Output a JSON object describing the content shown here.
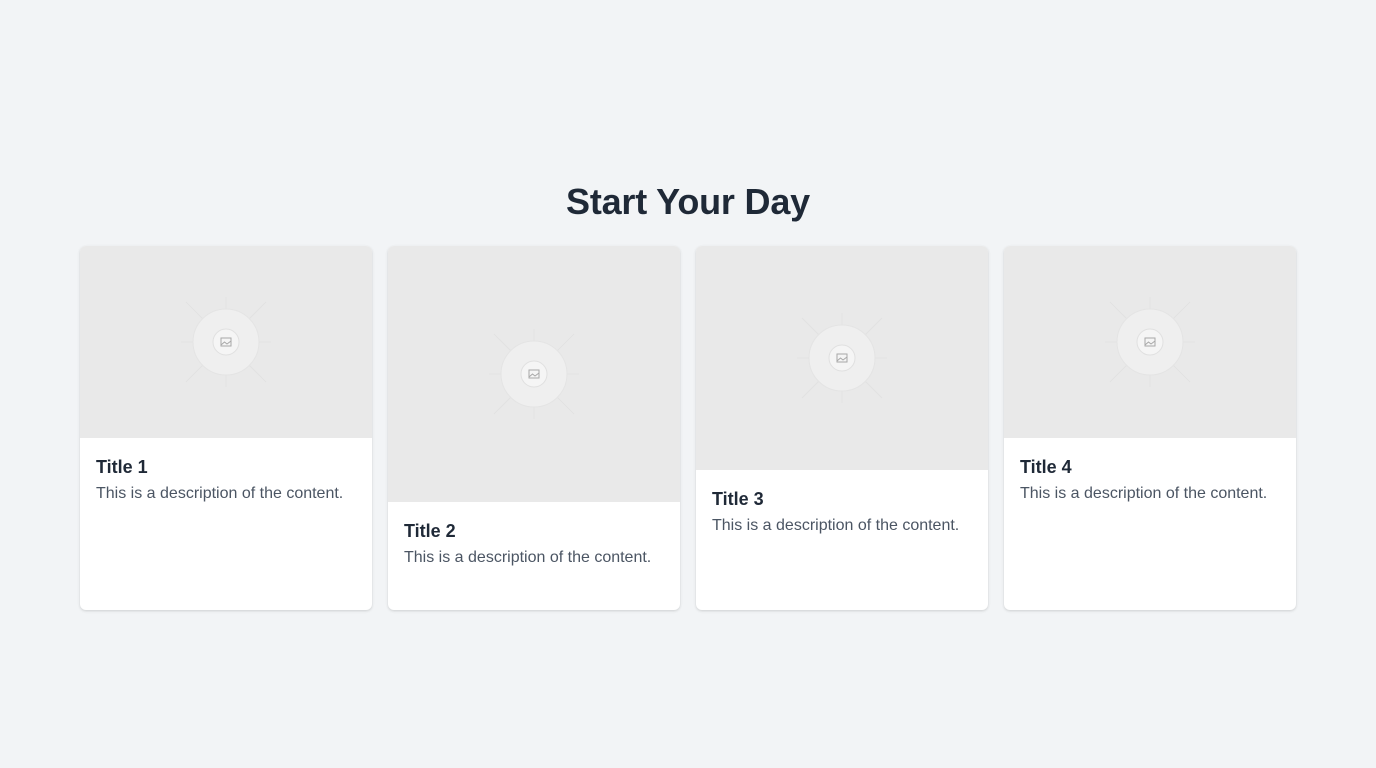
{
  "page": {
    "heading": "Start Your Day"
  },
  "cards": [
    {
      "title": "Title 1",
      "description": "This is a description of the content.",
      "image_icon": "image-placeholder-icon"
    },
    {
      "title": "Title 2",
      "description": "This is a description of the content.",
      "image_icon": "image-placeholder-icon"
    },
    {
      "title": "Title 3",
      "description": "This is a description of the content.",
      "image_icon": "image-placeholder-icon"
    },
    {
      "title": "Title 4",
      "description": "This is a description of the content.",
      "image_icon": "image-placeholder-icon"
    }
  ],
  "colors": {
    "background": "#f2f4f6",
    "heading": "#1f2937",
    "description": "#4b5563",
    "placeholder": "#e9e9e9"
  }
}
